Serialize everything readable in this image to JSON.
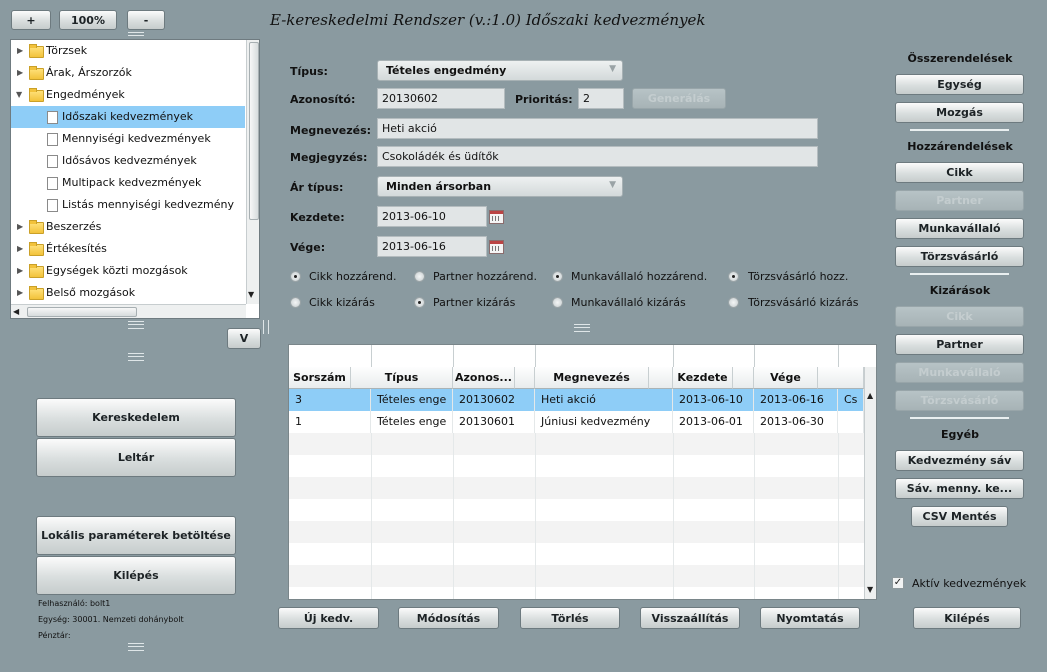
{
  "title": "E-kereskedelmi Rendszer (v.:1.0)  Időszaki kedvezmények",
  "zoom": {
    "plus": "+",
    "value": "100%",
    "minus": "-"
  },
  "tree": {
    "items": [
      {
        "label": "Törzsek"
      },
      {
        "label": "Árak, Árszorzók"
      },
      {
        "label": "Engedmények"
      },
      {
        "label": "Időszaki kedvezmények"
      },
      {
        "label": "Mennyiségi kedvezmények"
      },
      {
        "label": "Idősávos kedvezmények"
      },
      {
        "label": "Multipack kedvezmények"
      },
      {
        "label": "Listás mennyiségi kedvezmény"
      },
      {
        "label": "Beszerzés"
      },
      {
        "label": "Értékesítés"
      },
      {
        "label": "Egységek közti mozgások"
      },
      {
        "label": "Belső mozgások"
      }
    ],
    "v_button": "V"
  },
  "left_buttons": {
    "kereskedelem": "Kereskedelem",
    "leltar": "Leltár",
    "lokalis": "Lokális paraméterek betöltése",
    "kilepes": "Kilépés"
  },
  "footer": {
    "user": "Felhasználó:  bolt1",
    "unit": "Egység:        30001. Nemzeti dohánybolt",
    "cashier": "Pénztár:"
  },
  "form": {
    "tipus_label": "Típus:",
    "tipus_value": "Tételes engedmény",
    "azonosito_label": "Azonosító:",
    "azonosito_value": "20130602",
    "prioritas_label": "Prioritás:",
    "prioritas_value": "2",
    "generalas": "Generálás",
    "megnevezes_label": "Megnevezés:",
    "megnevezes_value": "Heti akció",
    "megjegyzes_label": "Megjegyzés:",
    "megjegyzes_value": "Csokoládék és üdítők",
    "artipus_label": "Ár típus:",
    "artipus_value": "Minden ársorban",
    "kezdete_label": "Kezdete:",
    "kezdete_value": "2013-06-10",
    "vege_label": "Vége:",
    "vege_value": "2013-06-16"
  },
  "radios": [
    {
      "label": "Cikk hozzárend.",
      "selected": true
    },
    {
      "label": "Partner hozzárend.",
      "selected": false
    },
    {
      "label": "Munkavállaló hozzárend.",
      "selected": true
    },
    {
      "label": "Törzsvásárló hozz.",
      "selected": true
    },
    {
      "label": "Cikk kizárás",
      "selected": false
    },
    {
      "label": "Partner kizárás",
      "selected": true
    },
    {
      "label": "Munkavállaló kizárás",
      "selected": false
    },
    {
      "label": "Törzsvásárló kizárás",
      "selected": false
    }
  ],
  "table": {
    "columns": [
      "Sorszám",
      "Típus",
      "Azonos...",
      "Megnevezés",
      "Kezdete",
      "Vége"
    ],
    "rows": [
      {
        "sorszam": "3",
        "tipus": "Tételes enge",
        "azonosito": "20130602",
        "megnevezes": "Heti akció",
        "kezdete": "2013-06-10",
        "vege": "2013-06-16",
        "extra": "Cs"
      },
      {
        "sorszam": "1",
        "tipus": "Tételes enge",
        "azonosito": "20130601",
        "megnevezes": "Júniusi kedvezmény",
        "kezdete": "2013-06-01",
        "vege": "2013-06-30",
        "extra": ""
      }
    ]
  },
  "bottom_buttons": {
    "uj": "Új kedv.",
    "modositas": "Módosítás",
    "torles": "Törlés",
    "visszaallitas": "Visszaállítás",
    "nyomtatas": "Nyomtatás",
    "kilepes": "Kilépés"
  },
  "right": {
    "osszerendelesek": "Összerendelések",
    "egyseg": "Egység",
    "mozgas": "Mozgás",
    "hozzarendelesek": "Hozzárendelések",
    "cikk": "Cikk",
    "partner_h": "Partner",
    "munkavallalo": "Munkavállaló",
    "torzsvasarlo": "Törzsvásárló",
    "kizarasok": "Kizárások",
    "cikk_k": "Cikk",
    "partner_k": "Partner",
    "munkavallalo_k": "Munkavállaló",
    "torzsvasarlo_k": "Törzsvásárló",
    "egyeb": "Egyéb",
    "kedv_sav": "Kedvezmény sáv",
    "sav_menny": "Sáv. menny. ke...",
    "csv": "CSV Mentés",
    "aktiv": "Aktív kedvezmények",
    "aktiv_checked": true
  },
  "colors": {
    "selection": "#8ecdf7",
    "background": "#8a9aa0"
  }
}
